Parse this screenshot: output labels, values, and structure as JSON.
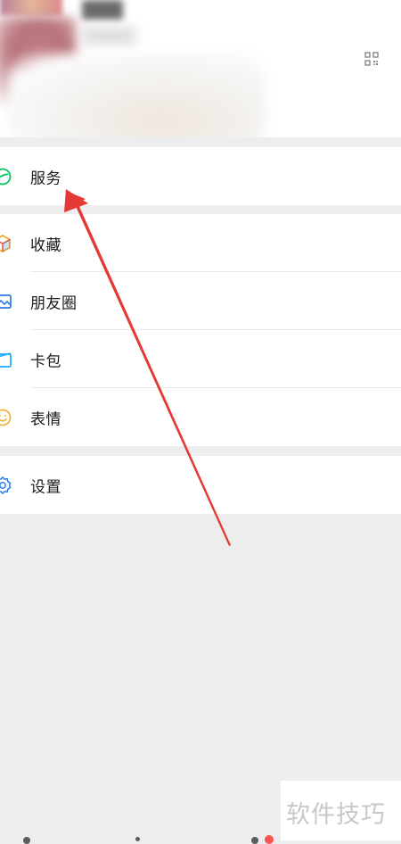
{
  "menu": {
    "service": {
      "label": "服务"
    },
    "favorites": {
      "label": "收藏"
    },
    "moments": {
      "label": "朋友圈"
    },
    "cards": {
      "label": "卡包"
    },
    "stickers": {
      "label": "表情"
    },
    "settings": {
      "label": "设置"
    }
  },
  "watermark": {
    "text": "软件技巧"
  },
  "colors": {
    "service_icon": "#07c160",
    "favorites_icon": "#f5a623",
    "moments_icon": "#2c7be5",
    "cards_icon": "#10aeff",
    "stickers_icon": "#f0b33a",
    "settings_icon": "#2c7be5",
    "annotation_arrow": "#e53935"
  }
}
